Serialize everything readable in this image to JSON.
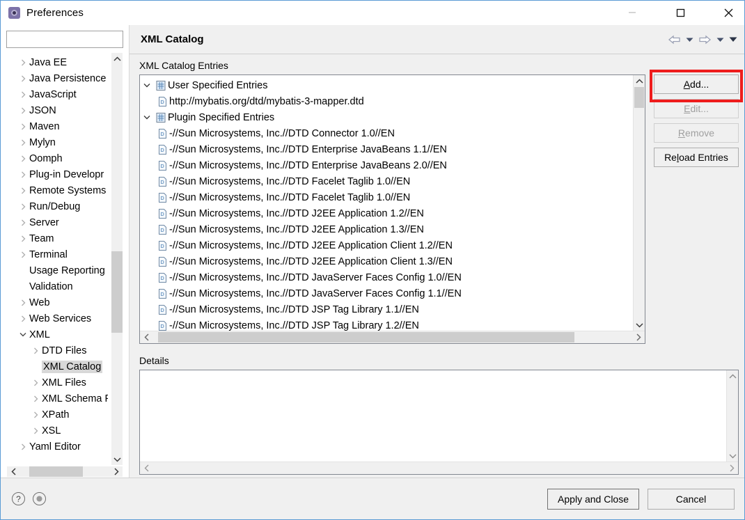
{
  "window": {
    "title": "Preferences",
    "app_icon": "preferences-gear-icon",
    "controls": {
      "minimize": "minimize-icon",
      "maximize": "maximize-icon",
      "close": "close-icon"
    }
  },
  "sidebar": {
    "search": {
      "value": "",
      "placeholder": ""
    },
    "items": [
      {
        "label": "Java EE",
        "depth": 0,
        "expandable": true,
        "expanded": false,
        "selected": false
      },
      {
        "label": "Java Persistence",
        "depth": 0,
        "expandable": true,
        "expanded": false,
        "selected": false
      },
      {
        "label": "JavaScript",
        "depth": 0,
        "expandable": true,
        "expanded": false,
        "selected": false
      },
      {
        "label": "JSON",
        "depth": 0,
        "expandable": true,
        "expanded": false,
        "selected": false
      },
      {
        "label": "Maven",
        "depth": 0,
        "expandable": true,
        "expanded": false,
        "selected": false
      },
      {
        "label": "Mylyn",
        "depth": 0,
        "expandable": true,
        "expanded": false,
        "selected": false
      },
      {
        "label": "Oomph",
        "depth": 0,
        "expandable": true,
        "expanded": false,
        "selected": false
      },
      {
        "label": "Plug-in Developr",
        "depth": 0,
        "expandable": true,
        "expanded": false,
        "selected": false
      },
      {
        "label": "Remote Systems",
        "depth": 0,
        "expandable": true,
        "expanded": false,
        "selected": false
      },
      {
        "label": "Run/Debug",
        "depth": 0,
        "expandable": true,
        "expanded": false,
        "selected": false
      },
      {
        "label": "Server",
        "depth": 0,
        "expandable": true,
        "expanded": false,
        "selected": false
      },
      {
        "label": "Team",
        "depth": 0,
        "expandable": true,
        "expanded": false,
        "selected": false
      },
      {
        "label": "Terminal",
        "depth": 0,
        "expandable": true,
        "expanded": false,
        "selected": false
      },
      {
        "label": "Usage Reporting",
        "depth": 0,
        "expandable": false,
        "expanded": false,
        "selected": false
      },
      {
        "label": "Validation",
        "depth": 0,
        "expandable": false,
        "expanded": false,
        "selected": false
      },
      {
        "label": "Web",
        "depth": 0,
        "expandable": true,
        "expanded": false,
        "selected": false
      },
      {
        "label": "Web Services",
        "depth": 0,
        "expandable": true,
        "expanded": false,
        "selected": false
      },
      {
        "label": "XML",
        "depth": 0,
        "expandable": true,
        "expanded": true,
        "selected": false
      },
      {
        "label": "DTD Files",
        "depth": 1,
        "expandable": true,
        "expanded": false,
        "selected": false
      },
      {
        "label": "XML Catalog",
        "depth": 1,
        "expandable": false,
        "expanded": false,
        "selected": true
      },
      {
        "label": "XML Files",
        "depth": 1,
        "expandable": true,
        "expanded": false,
        "selected": false
      },
      {
        "label": "XML Schema F",
        "depth": 1,
        "expandable": true,
        "expanded": false,
        "selected": false
      },
      {
        "label": "XPath",
        "depth": 1,
        "expandable": true,
        "expanded": false,
        "selected": false
      },
      {
        "label": "XSL",
        "depth": 1,
        "expandable": true,
        "expanded": false,
        "selected": false
      },
      {
        "label": "Yaml Editor",
        "depth": 0,
        "expandable": true,
        "expanded": false,
        "selected": false
      }
    ],
    "scroll_up_icon": "chevron-up-icon",
    "scroll_down_icon": "chevron-down-icon",
    "scroll_left_icon": "chevron-left-icon",
    "scroll_right_icon": "chevron-right-icon"
  },
  "page": {
    "title": "XML Catalog",
    "nav": {
      "back_icon": "back-arrow-icon",
      "back_menu_icon": "chevron-down-icon",
      "forward_icon": "forward-arrow-icon",
      "forward_menu_icon": "chevron-down-icon",
      "menu_icon": "chevron-down-icon"
    },
    "entries_group_label": "XML Catalog Entries",
    "entries": [
      {
        "label": "User Specified Entries",
        "depth": 0,
        "icon": "xml-catalog-icon",
        "expanded": true
      },
      {
        "label": "http://mybatis.org/dtd/mybatis-3-mapper.dtd",
        "depth": 1,
        "icon": "dtd-document-icon"
      },
      {
        "label": "Plugin Specified Entries",
        "depth": 0,
        "icon": "xml-catalog-icon",
        "expanded": true
      },
      {
        "label": "-//Sun Microsystems, Inc.//DTD Connector 1.0//EN",
        "depth": 1,
        "icon": "dtd-document-icon"
      },
      {
        "label": "-//Sun Microsystems, Inc.//DTD Enterprise JavaBeans 1.1//EN",
        "depth": 1,
        "icon": "dtd-document-icon"
      },
      {
        "label": "-//Sun Microsystems, Inc.//DTD Enterprise JavaBeans 2.0//EN",
        "depth": 1,
        "icon": "dtd-document-icon"
      },
      {
        "label": "-//Sun Microsystems, Inc.//DTD Facelet Taglib 1.0//EN",
        "depth": 1,
        "icon": "dtd-document-icon"
      },
      {
        "label": "-//Sun Microsystems, Inc.//DTD Facelet Taglib 1.0//EN",
        "depth": 1,
        "icon": "dtd-document-icon"
      },
      {
        "label": "-//Sun Microsystems, Inc.//DTD J2EE Application 1.2//EN",
        "depth": 1,
        "icon": "dtd-document-icon"
      },
      {
        "label": "-//Sun Microsystems, Inc.//DTD J2EE Application 1.3//EN",
        "depth": 1,
        "icon": "dtd-document-icon"
      },
      {
        "label": "-//Sun Microsystems, Inc.//DTD J2EE Application Client 1.2//EN",
        "depth": 1,
        "icon": "dtd-document-icon"
      },
      {
        "label": "-//Sun Microsystems, Inc.//DTD J2EE Application Client 1.3//EN",
        "depth": 1,
        "icon": "dtd-document-icon"
      },
      {
        "label": "-//Sun Microsystems, Inc.//DTD JavaServer Faces Config 1.0//EN",
        "depth": 1,
        "icon": "dtd-document-icon"
      },
      {
        "label": "-//Sun Microsystems, Inc.//DTD JavaServer Faces Config 1.1//EN",
        "depth": 1,
        "icon": "dtd-document-icon"
      },
      {
        "label": "-//Sun Microsystems, Inc.//DTD JSP Tag Library 1.1//EN",
        "depth": 1,
        "icon": "dtd-document-icon"
      },
      {
        "label": "-//Sun Microsystems, Inc.//DTD JSP Tag Library 1.2//EN",
        "depth": 1,
        "icon": "dtd-document-icon"
      }
    ],
    "buttons": {
      "add": {
        "label": "Add...",
        "mnemonic": "A",
        "enabled": true,
        "highlighted": true
      },
      "edit": {
        "label": "Edit...",
        "mnemonic": "E",
        "enabled": false,
        "highlighted": false
      },
      "remove": {
        "label": "Remove",
        "mnemonic": "R",
        "enabled": false,
        "highlighted": false
      },
      "reload": {
        "label": "Reload Entries",
        "mnemonic": "l",
        "enabled": true,
        "highlighted": false
      }
    },
    "details_group_label": "Details",
    "details_text": ""
  },
  "footer": {
    "help_icon": "help-question-icon",
    "info_icon": "info-circle-icon",
    "apply_and_close_label": "Apply and Close",
    "cancel_label": "Cancel"
  },
  "colors": {
    "highlight": "#ee1c1c",
    "window_border": "#5b9bd5",
    "chrome": "#f0f0f0",
    "selection": "#d8d8d8"
  }
}
